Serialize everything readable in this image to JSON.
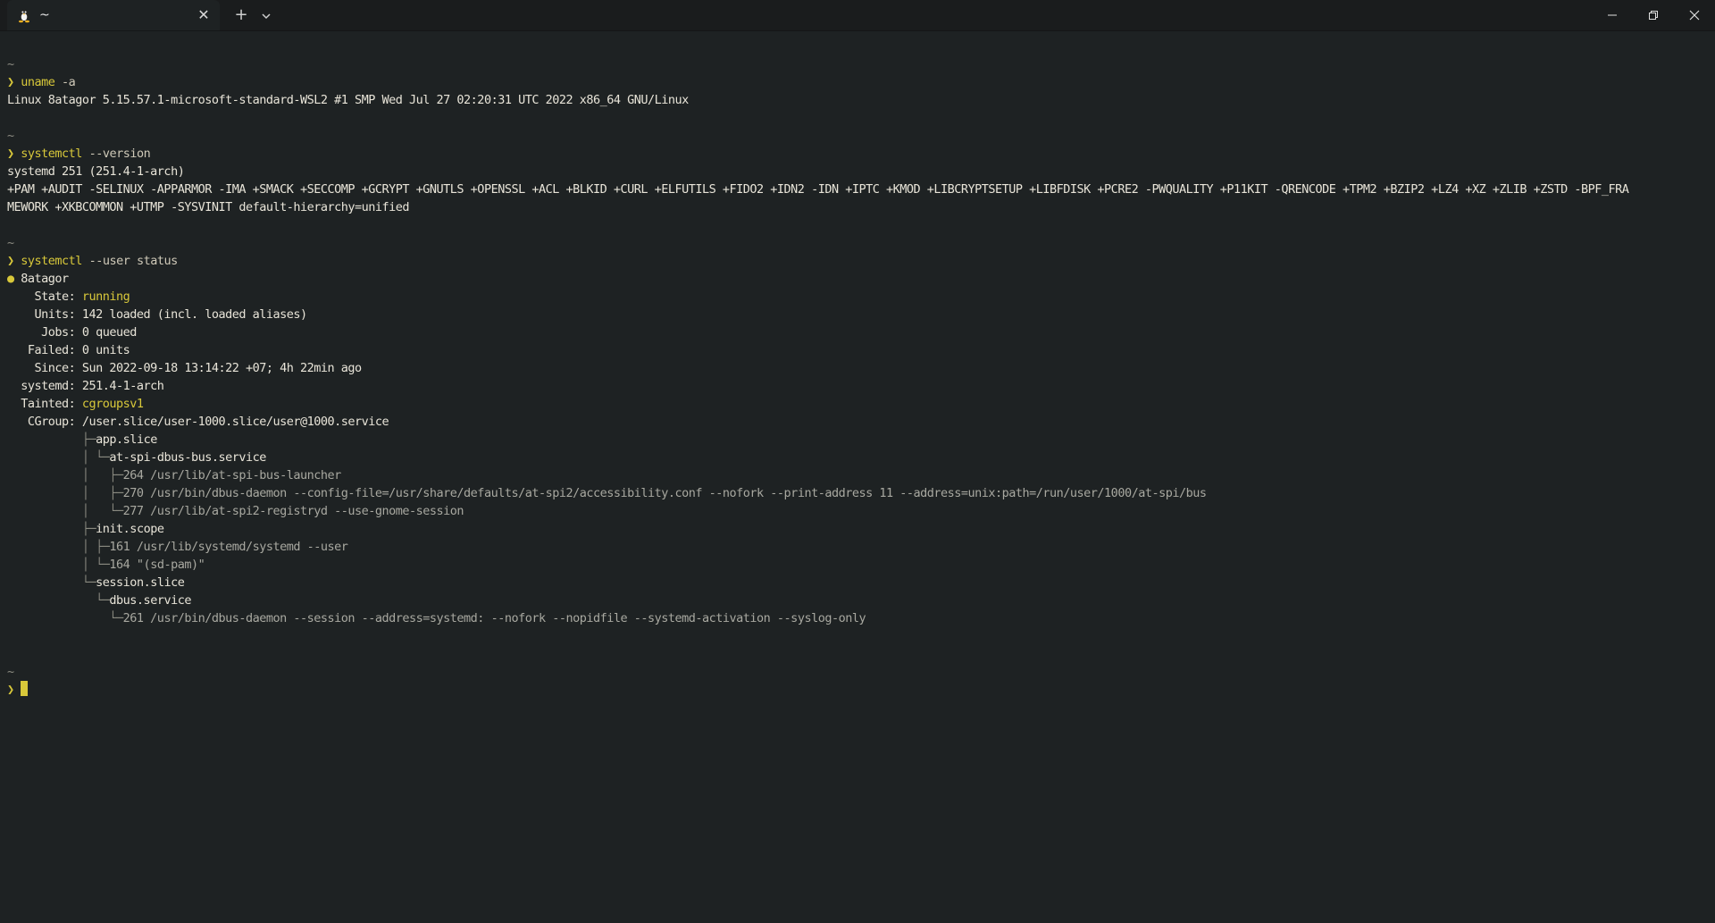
{
  "window": {
    "tab_title": "~",
    "tab_close": "✕",
    "new_tab": "+",
    "dropdown": "⌄",
    "tab_icon": "tux-icon"
  },
  "colors": {
    "background": "#1e2223",
    "accent": "#d8c83a",
    "text": "#e8e4d8",
    "dim": "#8a8a80"
  },
  "terminal": {
    "tilde": "~",
    "prompt_symbol": "❯",
    "block1": {
      "cmd": "uname",
      "args": " -a",
      "output": "Linux 8atagor 5.15.57.1-microsoft-standard-WSL2 #1 SMP Wed Jul 27 02:20:31 UTC 2022 x86_64 GNU/Linux"
    },
    "block2": {
      "cmd": "systemctl",
      "args": " --version",
      "output1": "systemd 251 (251.4-1-arch)",
      "output2": "+PAM +AUDIT -SELINUX -APPARMOR -IMA +SMACK +SECCOMP +GCRYPT +GNUTLS +OPENSSL +ACL +BLKID +CURL +ELFUTILS +FIDO2 +IDN2 -IDN +IPTC +KMOD +LIBCRYPTSETUP +LIBFDISK +PCRE2 -PWQUALITY +P11KIT -QRENCODE +TPM2 +BZIP2 +LZ4 +XZ +ZLIB +ZSTD -BPF_FRA",
      "output3": "MEWORK +XKBCOMMON +UTMP -SYSVINIT default-hierarchy=unified"
    },
    "block3": {
      "cmd": "systemctl",
      "args": " --user status",
      "host_bullet": "●",
      "host": "8atagor",
      "state_label": "    State: ",
      "state_value": "running",
      "units": "    Units: 142 loaded (incl. loaded aliases)",
      "jobs": "     Jobs: 0 queued",
      "failed": "   Failed: 0 units",
      "since": "    Since: Sun 2022-09-18 13:14:22 +07; 4h 22min ago",
      "systemd": "  systemd: 251.4-1-arch",
      "tainted_label": "  Tainted: ",
      "tainted_value": "cgroupsv1",
      "cgroup": "   CGroup: /user.slice/user-1000.slice/user@1000.service",
      "tree": [
        {
          "prefix": "           ├─",
          "text": "app.slice",
          "style": ""
        },
        {
          "prefix": "           │ └─",
          "text": "at-spi-dbus-bus.service",
          "style": ""
        },
        {
          "prefix": "           │   ├─",
          "text": "264 /usr/lib/at-spi-bus-launcher",
          "style": "gray"
        },
        {
          "prefix": "           │   ├─",
          "text": "270 /usr/bin/dbus-daemon --config-file=/usr/share/defaults/at-spi2/accessibility.conf --nofork --print-address 11 --address=unix:path=/run/user/1000/at-spi/bus",
          "style": "gray"
        },
        {
          "prefix": "           │   └─",
          "text": "277 /usr/lib/at-spi2-registryd --use-gnome-session",
          "style": "gray"
        },
        {
          "prefix": "           ├─",
          "text": "init.scope",
          "style": ""
        },
        {
          "prefix": "           │ ├─",
          "text": "161 /usr/lib/systemd/systemd --user",
          "style": "gray"
        },
        {
          "prefix": "           │ └─",
          "text": "164 \"(sd-pam)\"",
          "style": "gray"
        },
        {
          "prefix": "           └─",
          "text": "session.slice",
          "style": ""
        },
        {
          "prefix": "             └─",
          "text": "dbus.service",
          "style": ""
        },
        {
          "prefix": "               └─",
          "text": "261 /usr/bin/dbus-daemon --session --address=systemd: --nofork --nopidfile --systemd-activation --syslog-only",
          "style": "gray"
        }
      ]
    }
  }
}
